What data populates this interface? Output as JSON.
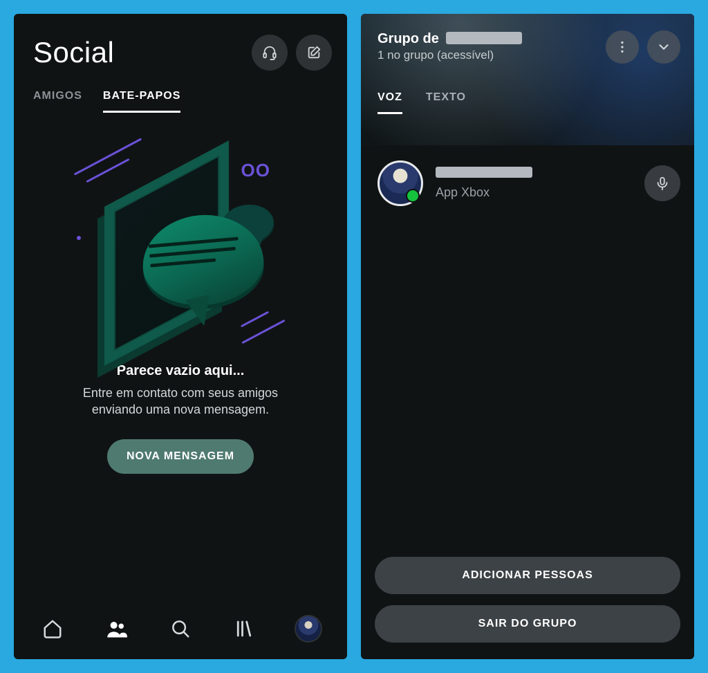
{
  "left": {
    "title": "Social",
    "header_icons": {
      "headset": "headset-icon",
      "compose": "compose-icon"
    },
    "tabs": {
      "friends": "AMIGOS",
      "chats": "BATE-PAPOS"
    },
    "active_tab": "chats",
    "empty": {
      "title": "Parece vazio aqui...",
      "subtitle": "Entre em contato com seus amigos enviando uma nova mensagem.",
      "button": "NOVA MENSAGEM"
    },
    "bottom_nav": {
      "home": "home-icon",
      "social": "people-icon",
      "search": "search-icon",
      "library": "library-icon",
      "profile": "avatar"
    }
  },
  "right": {
    "title_prefix": "Grupo de",
    "title_name_redacted": true,
    "subtitle": "1 no grupo (acessível)",
    "actions": {
      "more": "more-vertical-icon",
      "collapse": "chevron-down-icon"
    },
    "tabs": {
      "voice": "VOZ",
      "text": "TEXTO"
    },
    "active_tab": "voice",
    "member": {
      "name_redacted": true,
      "subtitle": "App Xbox",
      "status": "online",
      "mic": "microphone-icon"
    },
    "buttons": {
      "add": "ADICIONAR PESSOAS",
      "leave": "SAIR DO GRUPO"
    }
  }
}
